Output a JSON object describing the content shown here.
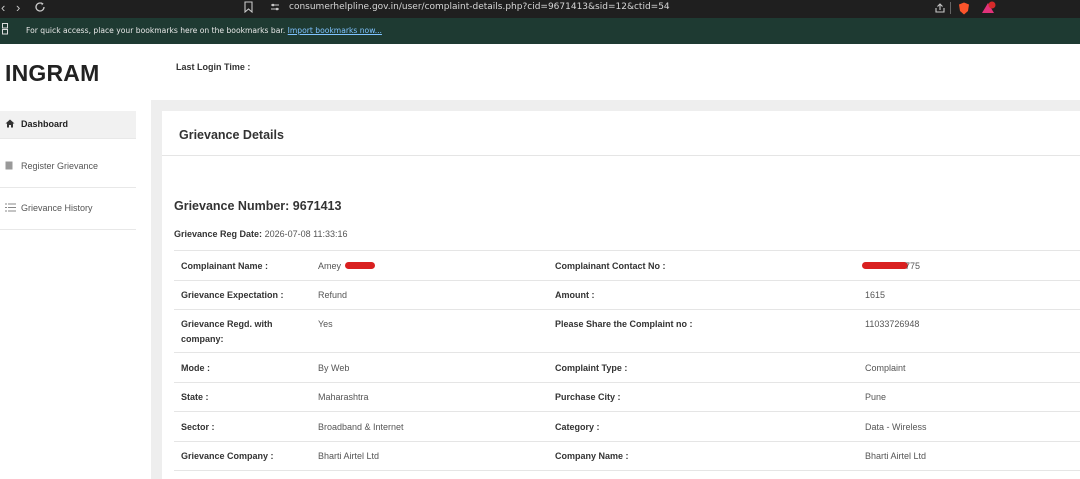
{
  "browser": {
    "url": "consumerhelpline.gov.in/user/complaint-details.php?cid=9671413&sid=12&ctid=54",
    "bookmarks_hint": "For quick access, place your bookmarks here on the bookmarks bar.",
    "import_link": "Import bookmarks now...",
    "icons": [
      "back-icon",
      "forward-icon",
      "reload-icon",
      "bookmark-icon",
      "site-info-icon",
      "share-icon",
      "brave-shield-icon",
      "rewards-icon"
    ]
  },
  "header": {
    "brand": "INGRAM",
    "last_login_label": "Last Login Time :"
  },
  "sidebar": {
    "items": [
      {
        "label": "Dashboard",
        "icon": "home-icon",
        "active": true
      },
      {
        "label": "Register Grievance",
        "icon": "document-icon",
        "active": false
      },
      {
        "label": "Grievance History",
        "icon": "list-icon",
        "active": false
      }
    ]
  },
  "main": {
    "title": "Grievance Details",
    "grievance_number": "Grievance Number: 9671413",
    "reg_date_label": "Grievance Reg Date:",
    "reg_date_value": "2026-07-08 11:33:16",
    "rows": [
      {
        "l1": "Complainant Name :",
        "v1": "Amey",
        "l2": "Complainant Contact No :",
        "v2": "775"
      },
      {
        "l1": "Grievance Expectation :",
        "v1": "Refund",
        "l2": "Amount :",
        "v2": "1615"
      },
      {
        "l1": "Grievance Regd. with",
        "l1b": "company:",
        "v1": "Yes",
        "l2": "Please Share the Complaint no :",
        "v2": "11033726948"
      },
      {
        "l1": "Mode :",
        "v1": "By Web",
        "l2": "Complaint Type :",
        "v2": "Complaint"
      },
      {
        "l1": "State :",
        "v1": "Maharashtra",
        "l2": "Purchase City :",
        "v2": "Pune"
      },
      {
        "l1": "Sector :",
        "v1": "Broadband & Internet",
        "l2": "Category :",
        "v2": "Data - Wireless"
      },
      {
        "l1": "Grievance Company :",
        "v1": "Bharti Airtel Ltd",
        "l2": "Company Name :",
        "v2": "Bharti Airtel Ltd"
      }
    ]
  },
  "colors": {
    "urlbar": "#1f1f1f",
    "bookmarkbar": "#1e3a32",
    "redaction": "#d92020"
  }
}
